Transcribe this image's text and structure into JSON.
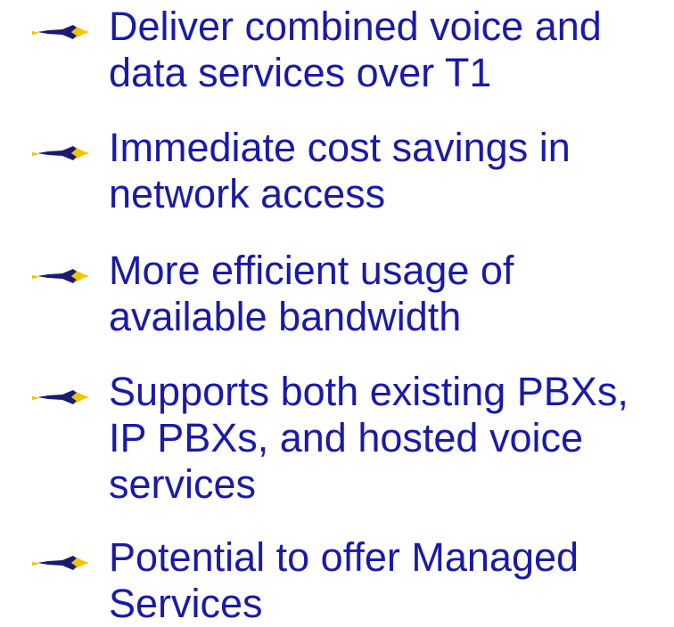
{
  "bullets": [
    {
      "icon": "arrow-pointer-icon",
      "text": "Deliver combined voice and\ndata services over T1"
    },
    {
      "icon": "arrow-pointer-icon",
      "text": "Immediate cost savings in\nnetwork access"
    },
    {
      "icon": "arrow-pointer-icon",
      "text": "More efficient usage of\navailable bandwidth"
    },
    {
      "icon": "arrow-pointer-icon",
      "text": "Supports both existing PBXs,\nIP PBXs, and hosted voice\nservices"
    },
    {
      "icon": "arrow-pointer-icon",
      "text": "Potential to offer Managed\nServices"
    }
  ],
  "colors": {
    "text": "#1a1aa8",
    "arrow_dark": "#1a1a6e",
    "arrow_light": "#f2c300"
  }
}
